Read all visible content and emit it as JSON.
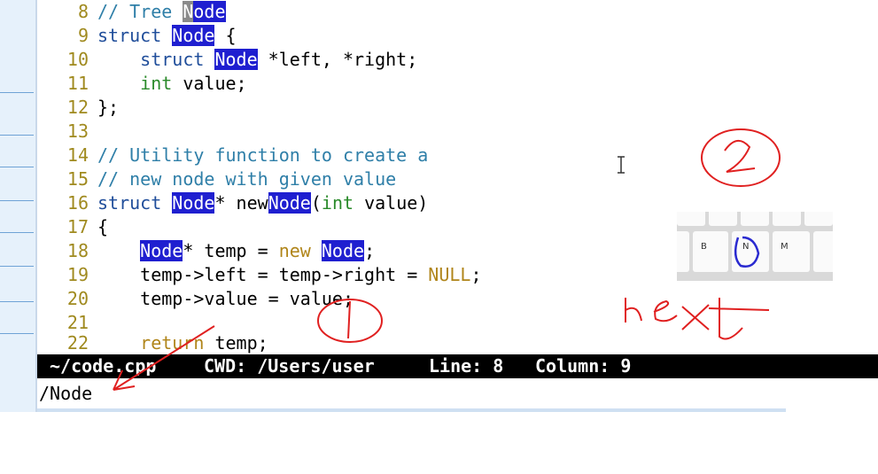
{
  "editor": {
    "lines": [
      {
        "num": "8"
      },
      {
        "num": "9"
      },
      {
        "num": "10"
      },
      {
        "num": "11"
      },
      {
        "num": "12"
      },
      {
        "num": "13"
      },
      {
        "num": "14"
      },
      {
        "num": "15"
      },
      {
        "num": "16"
      },
      {
        "num": "17"
      },
      {
        "num": "18"
      },
      {
        "num": "19"
      },
      {
        "num": "20"
      },
      {
        "num": "21"
      },
      {
        "num": "22"
      }
    ],
    "tokens": {
      "c8a": "// Tree ",
      "c8cur": "N",
      "c8b": "ode",
      "kw_struct": "struct",
      "node": "Node",
      "brace_open": " {",
      "kw_struct10": "struct",
      "node10": "Node",
      "ptrs10": " *left, *right;",
      "int11": "int",
      "value11": " value;",
      "close12": "};",
      "comment14": "// Utility function to create a",
      "comment15": "// new node with given value",
      "kw_struct16": "struct",
      "node16": "Node",
      "star16": "* new",
      "node16b": "Node",
      "paren16": "(",
      "int16": "int",
      "value16": " value)",
      "brace17": "{",
      "node18": "Node",
      "mid18": "* temp = ",
      "new18": "new",
      "space18": " ",
      "node18b": "Node",
      "semi18": ";",
      "l19a": "temp->left = temp->right = ",
      "null19": "NULL",
      "semi19": ";",
      "l20": "temp->value = value;",
      "ret22": "return",
      "temp22": " temp;"
    }
  },
  "status_bar": {
    "file": "~/code.cpp",
    "cwd_label": "CWD: /Users/user",
    "line_label": "Line: 8",
    "column_label": "Column: 9"
  },
  "command_line": {
    "text": "/Node"
  },
  "keyboard_overlay": {
    "keys": [
      "B",
      "N",
      "M"
    ]
  },
  "annotations": {
    "note": "next",
    "circle_1": "1",
    "circle_2": "2"
  },
  "colors": {
    "highlight": "#1f1fd0",
    "comment": "#2f7fa8",
    "keyword": "#1f4d9a",
    "type": "#2a8a2a",
    "line_number": "#a08a1f",
    "annotation_red": "#e02020",
    "annotation_blue": "#2a2ad0"
  }
}
